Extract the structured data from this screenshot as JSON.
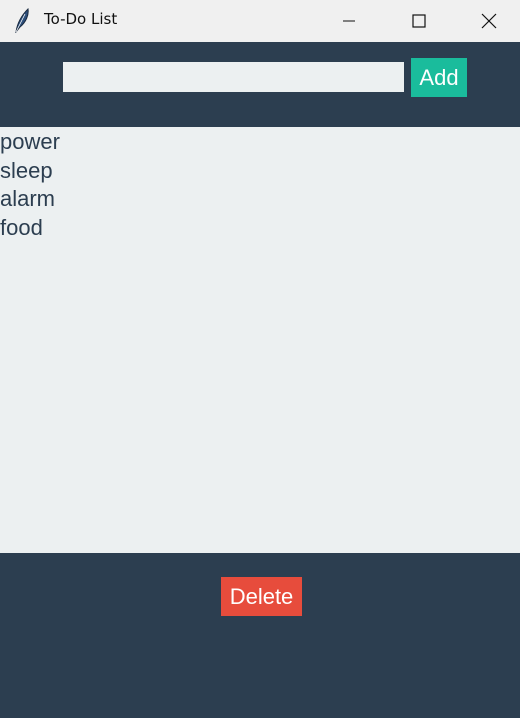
{
  "window": {
    "title": "To-Do List",
    "icon": "feather-icon"
  },
  "header": {
    "entry_value": "",
    "add_label": "Add"
  },
  "list": {
    "items": [
      {
        "label": "power"
      },
      {
        "label": "sleep"
      },
      {
        "label": "alarm"
      },
      {
        "label": "food"
      }
    ]
  },
  "footer": {
    "delete_label": "Delete"
  },
  "colors": {
    "background": "#2c3e50",
    "list_background": "#ecf0f1",
    "add_button": "#1abc9c",
    "delete_button": "#e74c3c",
    "titlebar": "#f0f0f0"
  }
}
